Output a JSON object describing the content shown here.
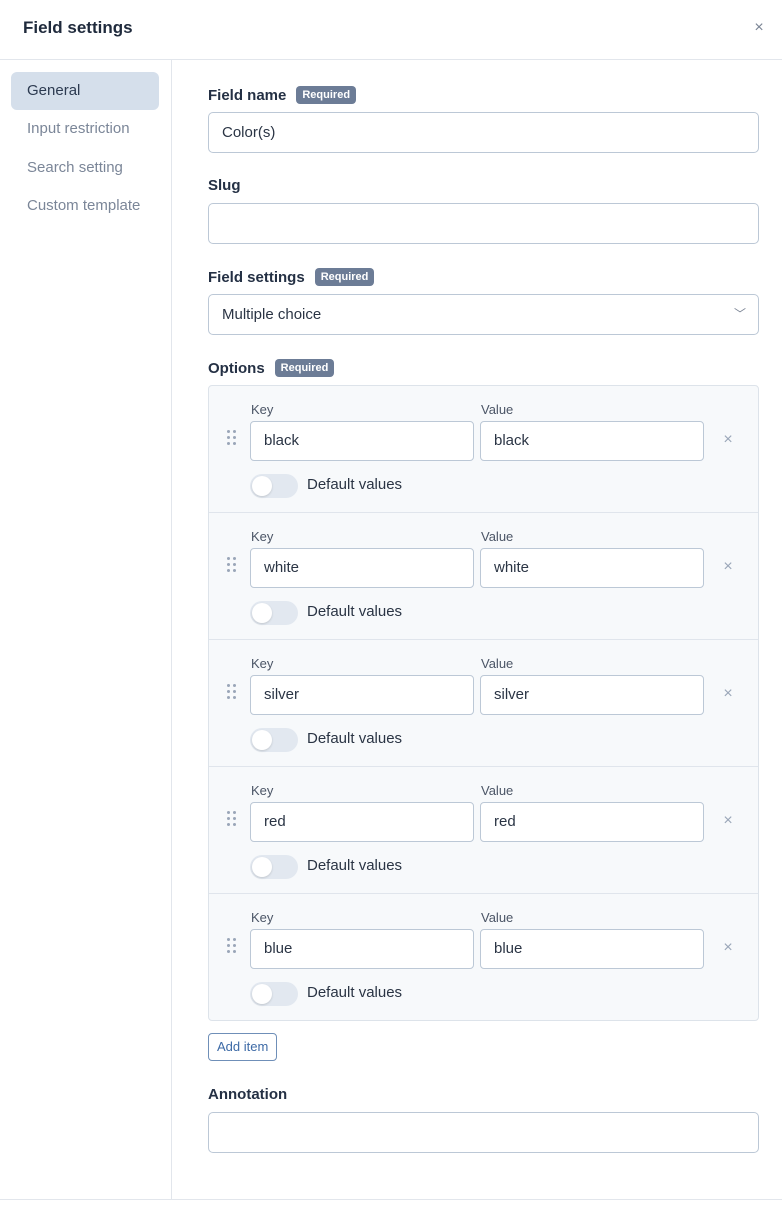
{
  "header": {
    "title": "Field settings",
    "close_icon": "×"
  },
  "sidebar": {
    "items": [
      {
        "label": "General",
        "active": true
      },
      {
        "label": "Input restriction",
        "active": false
      },
      {
        "label": "Search setting",
        "active": false
      },
      {
        "label": "Custom template",
        "active": false
      }
    ]
  },
  "form": {
    "field_name": {
      "label": "Field name",
      "badge": "Required",
      "value": "Color(s)"
    },
    "slug": {
      "label": "Slug",
      "value": ""
    },
    "field_settings": {
      "label": "Field settings",
      "badge": "Required",
      "value": "Multiple choice",
      "chevron": "﹀"
    },
    "options": {
      "label": "Options",
      "badge": "Required",
      "key_label": "Key",
      "value_label": "Value",
      "default_label": "Default values",
      "remove_icon": "×",
      "items": [
        {
          "key": "black",
          "value": "black",
          "default": false
        },
        {
          "key": "white",
          "value": "white",
          "default": false
        },
        {
          "key": "silver",
          "value": "silver",
          "default": false
        },
        {
          "key": "red",
          "value": "red",
          "default": false
        },
        {
          "key": "blue",
          "value": "blue",
          "default": false
        }
      ]
    },
    "add_item_label": "Add item",
    "annotation": {
      "label": "Annotation",
      "value": ""
    }
  }
}
